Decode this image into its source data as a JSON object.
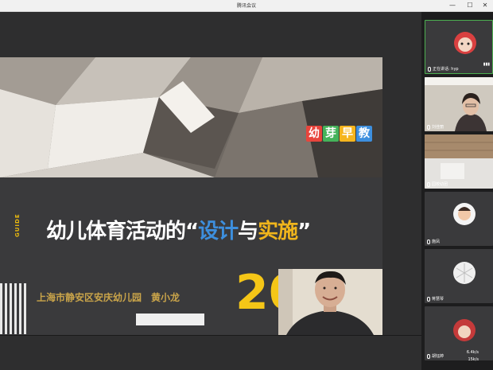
{
  "window": {
    "title": "腾讯会议"
  },
  "slide": {
    "logo_chars": [
      "幼",
      "芽",
      "早",
      "教"
    ],
    "logo_colors": [
      "#e8453c",
      "#45b35a",
      "#f5b51e",
      "#3d8fde"
    ],
    "guide": "GUIDE",
    "title_part1": "幼儿体育活动的",
    "title_q1": "“",
    "title_highlight1": "设计",
    "title_mid": "与",
    "title_highlight2": "实施",
    "title_q2": "”",
    "subtitle": "上海市静安区安庆幼儿园　黄小龙",
    "year": "20"
  },
  "participants": [
    {
      "name": "正在讲话: hyp",
      "speaking": true
    },
    {
      "name": "刘佳丽"
    },
    {
      "name": "园校幼团"
    },
    {
      "name": "施凤"
    },
    {
      "name": "蒋慧琴"
    },
    {
      "name": "胡钰婷"
    }
  ],
  "status": {
    "up": "6.4k/s",
    "down": "15k/s"
  }
}
